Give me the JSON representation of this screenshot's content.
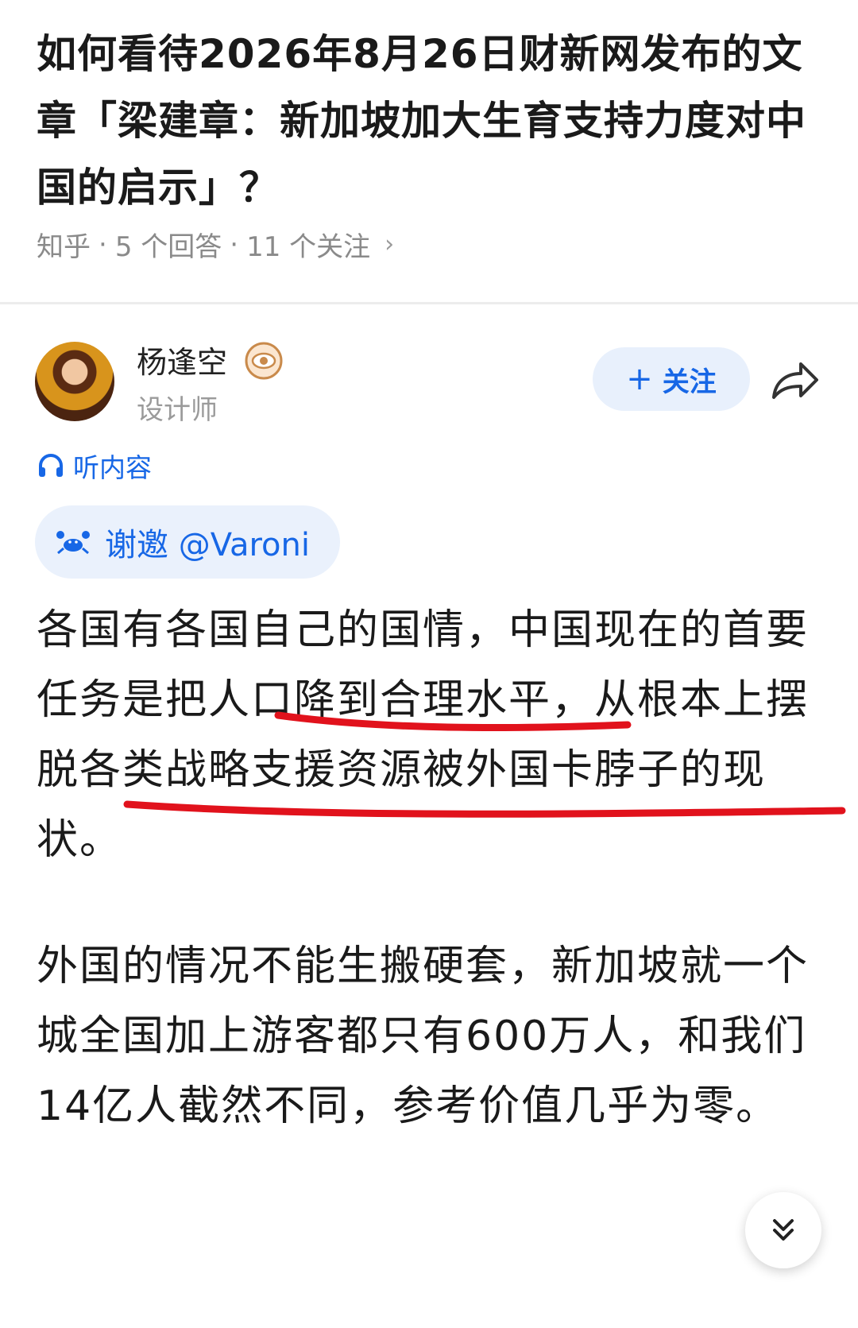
{
  "question": {
    "title": "如何看待2026年8月26日财新网发布的文章「梁建章：新加坡加大生育支持力度对中国的启示」？",
    "source": "知乎",
    "answers": "5 个回答",
    "followers": "11 个关注",
    "separator": "·"
  },
  "author": {
    "name": "杨逢空",
    "role": "设计师",
    "badge_icon": "eye-badge-icon"
  },
  "actions": {
    "follow_plus": "+",
    "follow_label": "关注",
    "share_icon": "share-icon"
  },
  "listen_label": "听内容",
  "thanks_label": "谢邀 @Varoni",
  "body": {
    "paragraph1": "各国有各国自己的国情，中国现在的首要任务是把人口降到合理水平，从根本上摆脱各类战略支援资源被外国卡脖子的现状。",
    "paragraph2": "外国的情况不能生搬硬套，新加坡就一个城全国加上游客都只有600万人，和我们14亿人截然不同，参考价值几乎为零。"
  },
  "colors": {
    "accent": "#1767e6",
    "underline": "#e1121c",
    "meta_text": "#8a8a8a"
  }
}
